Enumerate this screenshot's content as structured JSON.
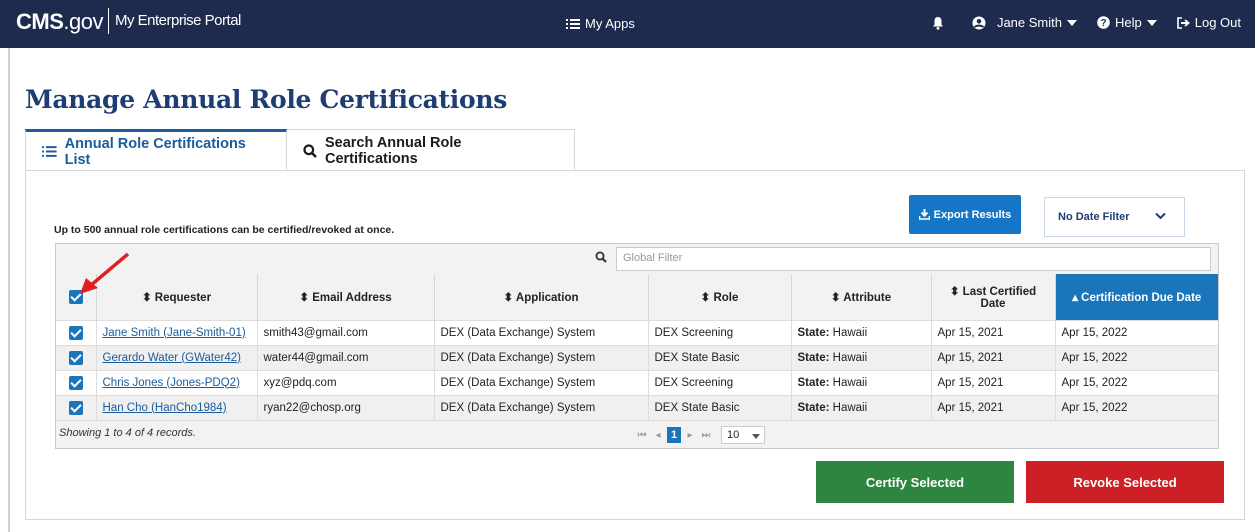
{
  "topbar": {
    "brand_cms": "CMS",
    "brand_gov": ".gov",
    "portal": "My Enterprise Portal",
    "my_apps": "My Apps",
    "user": "Jane Smith",
    "help": "Help",
    "logout": "Log Out"
  },
  "page": {
    "title": "Manage Annual Role Certifications",
    "tabs": [
      {
        "label": "Annual Role Certifications List",
        "icon": "list-icon",
        "active": true
      },
      {
        "label": "Search Annual Role Certifications",
        "icon": "search-icon",
        "active": false
      }
    ],
    "note": "Up to 500 annual role certifications can be certified/revoked at once.",
    "export_label": "Export Results",
    "date_filter": "No Date Filter",
    "global_filter_placeholder": "Global Filter"
  },
  "table": {
    "columns": [
      "Requester",
      "Email Address",
      "Application",
      "Role",
      "Attribute",
      "Last Certified Date",
      "Certification Due Date"
    ],
    "rows": [
      {
        "requester": "Jane Smith (Jane-Smith-01)",
        "email": "smith43@gmail.com",
        "application": "DEX (Data Exchange) System",
        "role": "DEX Screening",
        "attr_key": "State:",
        "attr_val": "Hawaii",
        "last": "Apr 15, 2021",
        "due": "Apr 15, 2022"
      },
      {
        "requester": "Gerardo Water (GWater42)",
        "email": "water44@gmail.com",
        "application": "DEX (Data Exchange) System",
        "role": "DEX State Basic",
        "attr_key": "State:",
        "attr_val": "Hawaii",
        "last": "Apr 15, 2021",
        "due": "Apr 15, 2022"
      },
      {
        "requester": "Chris Jones (Jones-PDQ2)",
        "email": "xyz@pdq.com",
        "application": "DEX (Data Exchange) System",
        "role": "DEX Screening",
        "attr_key": "State:",
        "attr_val": "Hawaii",
        "last": "Apr 15, 2021",
        "due": "Apr 15, 2022"
      },
      {
        "requester": "Han Cho (HanCho1984)",
        "email": "ryan22@chosp.org",
        "application": "DEX (Data Exchange) System",
        "role": "DEX State Basic",
        "attr_key": "State:",
        "attr_val": "Hawaii",
        "last": "Apr 15, 2021",
        "due": "Apr 15, 2022"
      }
    ],
    "showing": "Showing 1 to 4 of 4 records.",
    "current_page": "1",
    "page_size": "10"
  },
  "actions": {
    "certify": "Certify Selected",
    "revoke": "Revoke Selected"
  },
  "colors": {
    "topbar": "#1e2b4e",
    "accent": "#1b75bb",
    "certify": "#2e8540",
    "revoke": "#cd2026",
    "annotation_arrow": "#e02020"
  }
}
